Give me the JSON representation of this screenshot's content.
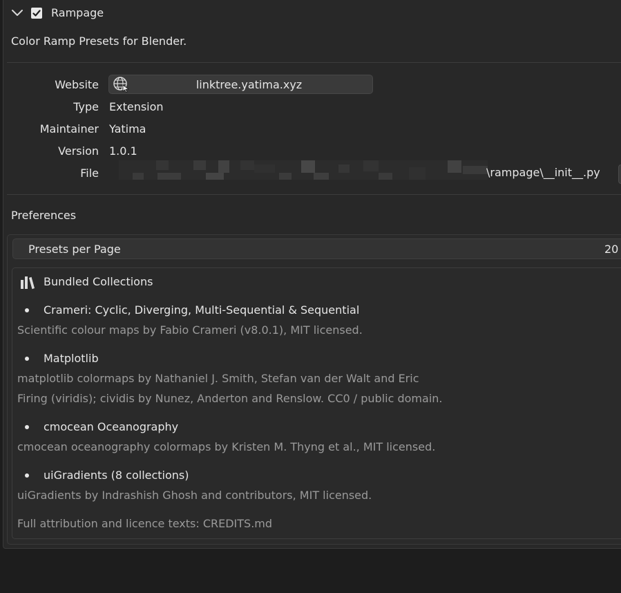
{
  "extension": {
    "name": "Rampage",
    "enabled": true,
    "description": "Color Ramp Presets for Blender."
  },
  "info": {
    "website_label": "Website",
    "website_value": "linktree.yatima.xyz",
    "type_label": "Type",
    "type_value": "Extension",
    "maintainer_label": "Maintainer",
    "maintainer_value": "Yatima",
    "version_label": "Version",
    "version_value": "1.0.1",
    "file_label": "File",
    "file_value_visible": "\\rampage\\__init__.py"
  },
  "preferences": {
    "title": "Preferences",
    "presets_per_page_label": "Presets per Page",
    "presets_per_page_value": "20",
    "bundled": {
      "title": "Bundled Collections",
      "items": [
        {
          "title": "Crameri: Cyclic, Diverging, Multi-Sequential & Sequential",
          "lines": [
            "Scientific colour maps by Fabio Crameri (v8.0.1), MIT licensed."
          ]
        },
        {
          "title": "Matplotlib",
          "lines": [
            "matplotlib colormaps by Nathaniel J. Smith, Stefan van der Walt and Eric",
            "Firing (viridis); cividis by Nunez, Anderton and Renslow. CC0 / public domain."
          ]
        },
        {
          "title": "cmocean Oceanography",
          "lines": [
            "cmocean oceanography colormaps by Kristen M. Thyng et al., MIT licensed."
          ]
        },
        {
          "title": "uiGradients (8 collections)",
          "lines": [
            "uiGradients by Indrashish Ghosh and contributors, MIT licensed."
          ]
        }
      ],
      "footer": "Full attribution and licence texts: CREDITS.md"
    }
  },
  "icons": {
    "collapse": "chevron-down-icon",
    "checkbox": "checkbox-checked-icon",
    "website": "globe-icon",
    "bundled": "books-icon"
  },
  "colors": {
    "background": "#1d1d1d",
    "panel": "#282828",
    "muted_text": "#9a9a9a",
    "field": "#3a3a3a"
  }
}
